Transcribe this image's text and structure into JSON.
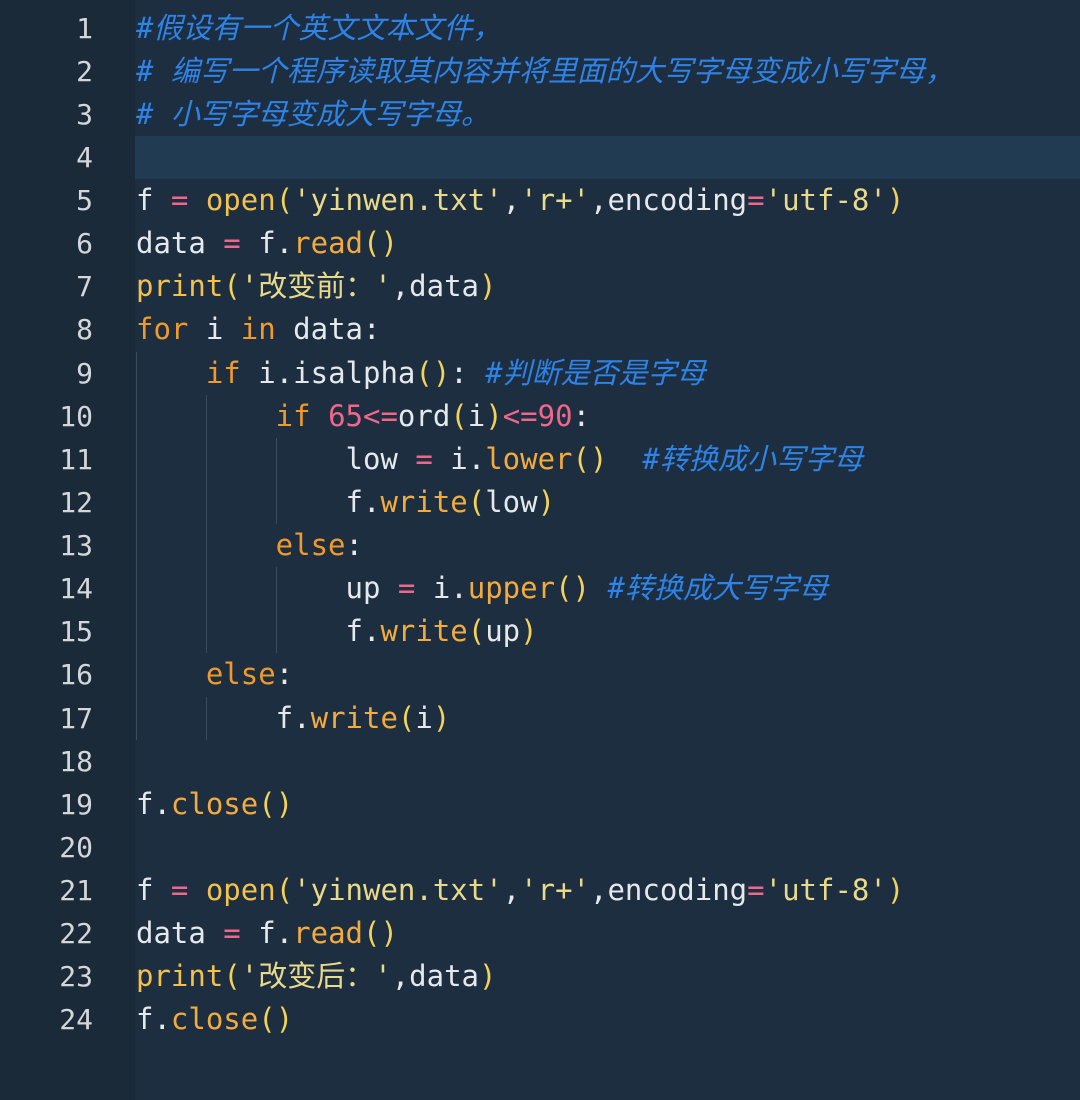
{
  "theme": {
    "editor_background": "#1c2e3f",
    "gutter_background": "#1a2a39",
    "current_line_background": "#213b53",
    "line_number_color": "#d4d7da",
    "indent_guide_color": "#3a4d5e"
  },
  "editor": {
    "current_line": 4,
    "lines": [
      {
        "number": "1",
        "tokens": [
          {
            "text": "#假设有一个英文文本文件，",
            "color": "#2f83e6",
            "italic": true
          }
        ]
      },
      {
        "number": "2",
        "tokens": [
          {
            "text": "# 编写一个程序读取其内容并将里面的大写字母变成小写字母，",
            "color": "#2f83e6",
            "italic": true
          }
        ]
      },
      {
        "number": "3",
        "tokens": [
          {
            "text": "# 小写字母变成大写字母。",
            "color": "#2f83e6",
            "italic": true
          }
        ]
      },
      {
        "number": "4",
        "tokens": []
      },
      {
        "number": "5",
        "tokens": [
          {
            "text": "f",
            "color": "#e6e9ec"
          },
          {
            "text": " =",
            "color": "#f0678b"
          },
          {
            "text": " open",
            "color": "#f2c14e"
          },
          {
            "text": "(",
            "color": "#f3d25a"
          },
          {
            "text": "'yinwen.txt'",
            "color": "#e9d98b"
          },
          {
            "text": ",",
            "color": "#e6e9ec"
          },
          {
            "text": "'r+'",
            "color": "#e9d98b"
          },
          {
            "text": ",encoding",
            "color": "#e6e9ec"
          },
          {
            "text": "=",
            "color": "#f0678b"
          },
          {
            "text": "'utf-8'",
            "color": "#e9d98b"
          },
          {
            "text": ")",
            "color": "#f3d25a"
          }
        ]
      },
      {
        "number": "6",
        "tokens": [
          {
            "text": "data",
            "color": "#e6e9ec"
          },
          {
            "text": " =",
            "color": "#f0678b"
          },
          {
            "text": " f.",
            "color": "#e6e9ec"
          },
          {
            "text": "read",
            "color": "#f4ab3e"
          },
          {
            "text": "()",
            "color": "#f3d25a"
          }
        ]
      },
      {
        "number": "7",
        "tokens": [
          {
            "text": "print",
            "color": "#f2c14e"
          },
          {
            "text": "(",
            "color": "#f3d25a"
          },
          {
            "text": "'改变前：'",
            "color": "#e9d98b"
          },
          {
            "text": ",data",
            "color": "#e6e9ec"
          },
          {
            "text": ")",
            "color": "#f3d25a"
          }
        ]
      },
      {
        "number": "8",
        "tokens": [
          {
            "text": "for",
            "color": "#f09a2e"
          },
          {
            "text": " i ",
            "color": "#e6e9ec"
          },
          {
            "text": "in",
            "color": "#f09a2e"
          },
          {
            "text": " data:",
            "color": "#e6e9ec"
          }
        ]
      },
      {
        "number": "9",
        "tokens": [
          {
            "text": "    if",
            "color": "#f09a2e"
          },
          {
            "text": " i.isalpha",
            "color": "#e6e9ec"
          },
          {
            "text": "()",
            "color": "#f3d25a"
          },
          {
            "text": ":",
            "color": "#e6e9ec"
          },
          {
            "text": " #判断是否是字母",
            "color": "#2f83e6",
            "italic": true
          }
        ]
      },
      {
        "number": "10",
        "tokens": [
          {
            "text": "        if",
            "color": "#f09a2e"
          },
          {
            "text": " 65",
            "color": "#f0678b"
          },
          {
            "text": "<=",
            "color": "#f0678b"
          },
          {
            "text": "ord",
            "color": "#e6e9ec"
          },
          {
            "text": "(",
            "color": "#f3d25a"
          },
          {
            "text": "i",
            "color": "#e6e9ec"
          },
          {
            "text": ")",
            "color": "#f3d25a"
          },
          {
            "text": "<=",
            "color": "#f0678b"
          },
          {
            "text": "90",
            "color": "#f0678b"
          },
          {
            "text": ":",
            "color": "#e6e9ec"
          }
        ]
      },
      {
        "number": "11",
        "tokens": [
          {
            "text": "            low",
            "color": "#e6e9ec"
          },
          {
            "text": " =",
            "color": "#f0678b"
          },
          {
            "text": " i.",
            "color": "#e6e9ec"
          },
          {
            "text": "lower",
            "color": "#f4ab3e"
          },
          {
            "text": "()",
            "color": "#f3d25a"
          },
          {
            "text": "  #转换成小写字母",
            "color": "#2f83e6",
            "italic": true
          }
        ]
      },
      {
        "number": "12",
        "tokens": [
          {
            "text": "            f.",
            "color": "#e6e9ec"
          },
          {
            "text": "write",
            "color": "#f4ab3e"
          },
          {
            "text": "(",
            "color": "#f3d25a"
          },
          {
            "text": "low",
            "color": "#e6e9ec"
          },
          {
            "text": ")",
            "color": "#f3d25a"
          }
        ]
      },
      {
        "number": "13",
        "tokens": [
          {
            "text": "        else",
            "color": "#f09a2e"
          },
          {
            "text": ":",
            "color": "#e6e9ec"
          }
        ]
      },
      {
        "number": "14",
        "tokens": [
          {
            "text": "            up",
            "color": "#e6e9ec"
          },
          {
            "text": " =",
            "color": "#f0678b"
          },
          {
            "text": " i.",
            "color": "#e6e9ec"
          },
          {
            "text": "upper",
            "color": "#f4ab3e"
          },
          {
            "text": "()",
            "color": "#f3d25a"
          },
          {
            "text": " #转换成大写字母",
            "color": "#2f83e6",
            "italic": true
          }
        ]
      },
      {
        "number": "15",
        "tokens": [
          {
            "text": "            f.",
            "color": "#e6e9ec"
          },
          {
            "text": "write",
            "color": "#f4ab3e"
          },
          {
            "text": "(",
            "color": "#f3d25a"
          },
          {
            "text": "up",
            "color": "#e6e9ec"
          },
          {
            "text": ")",
            "color": "#f3d25a"
          }
        ]
      },
      {
        "number": "16",
        "tokens": [
          {
            "text": "    else",
            "color": "#f09a2e"
          },
          {
            "text": ":",
            "color": "#e6e9ec"
          }
        ]
      },
      {
        "number": "17",
        "tokens": [
          {
            "text": "        f.",
            "color": "#e6e9ec"
          },
          {
            "text": "write",
            "color": "#f4ab3e"
          },
          {
            "text": "(",
            "color": "#f3d25a"
          },
          {
            "text": "i",
            "color": "#e6e9ec"
          },
          {
            "text": ")",
            "color": "#f3d25a"
          }
        ]
      },
      {
        "number": "18",
        "tokens": []
      },
      {
        "number": "19",
        "tokens": [
          {
            "text": "f.",
            "color": "#e6e9ec"
          },
          {
            "text": "close",
            "color": "#f4ab3e"
          },
          {
            "text": "()",
            "color": "#f3d25a"
          }
        ]
      },
      {
        "number": "20",
        "tokens": []
      },
      {
        "number": "21",
        "tokens": [
          {
            "text": "f",
            "color": "#e6e9ec"
          },
          {
            "text": " =",
            "color": "#f0678b"
          },
          {
            "text": " open",
            "color": "#f2c14e"
          },
          {
            "text": "(",
            "color": "#f3d25a"
          },
          {
            "text": "'yinwen.txt'",
            "color": "#e9d98b"
          },
          {
            "text": ",",
            "color": "#e6e9ec"
          },
          {
            "text": "'r+'",
            "color": "#e9d98b"
          },
          {
            "text": ",encoding",
            "color": "#e6e9ec"
          },
          {
            "text": "=",
            "color": "#f0678b"
          },
          {
            "text": "'utf-8'",
            "color": "#e9d98b"
          },
          {
            "text": ")",
            "color": "#f3d25a"
          }
        ]
      },
      {
        "number": "22",
        "tokens": [
          {
            "text": "data",
            "color": "#e6e9ec"
          },
          {
            "text": " =",
            "color": "#f0678b"
          },
          {
            "text": " f.",
            "color": "#e6e9ec"
          },
          {
            "text": "read",
            "color": "#f4ab3e"
          },
          {
            "text": "()",
            "color": "#f3d25a"
          }
        ]
      },
      {
        "number": "23",
        "tokens": [
          {
            "text": "print",
            "color": "#f2c14e"
          },
          {
            "text": "(",
            "color": "#f3d25a"
          },
          {
            "text": "'改变后：'",
            "color": "#e9d98b"
          },
          {
            "text": ",data",
            "color": "#e6e9ec"
          },
          {
            "text": ")",
            "color": "#f3d25a"
          }
        ]
      },
      {
        "number": "24",
        "tokens": [
          {
            "text": "f.",
            "color": "#e6e9ec"
          },
          {
            "text": "close",
            "color": "#f4ab3e"
          },
          {
            "text": "()",
            "color": "#f3d25a"
          }
        ]
      }
    ]
  }
}
